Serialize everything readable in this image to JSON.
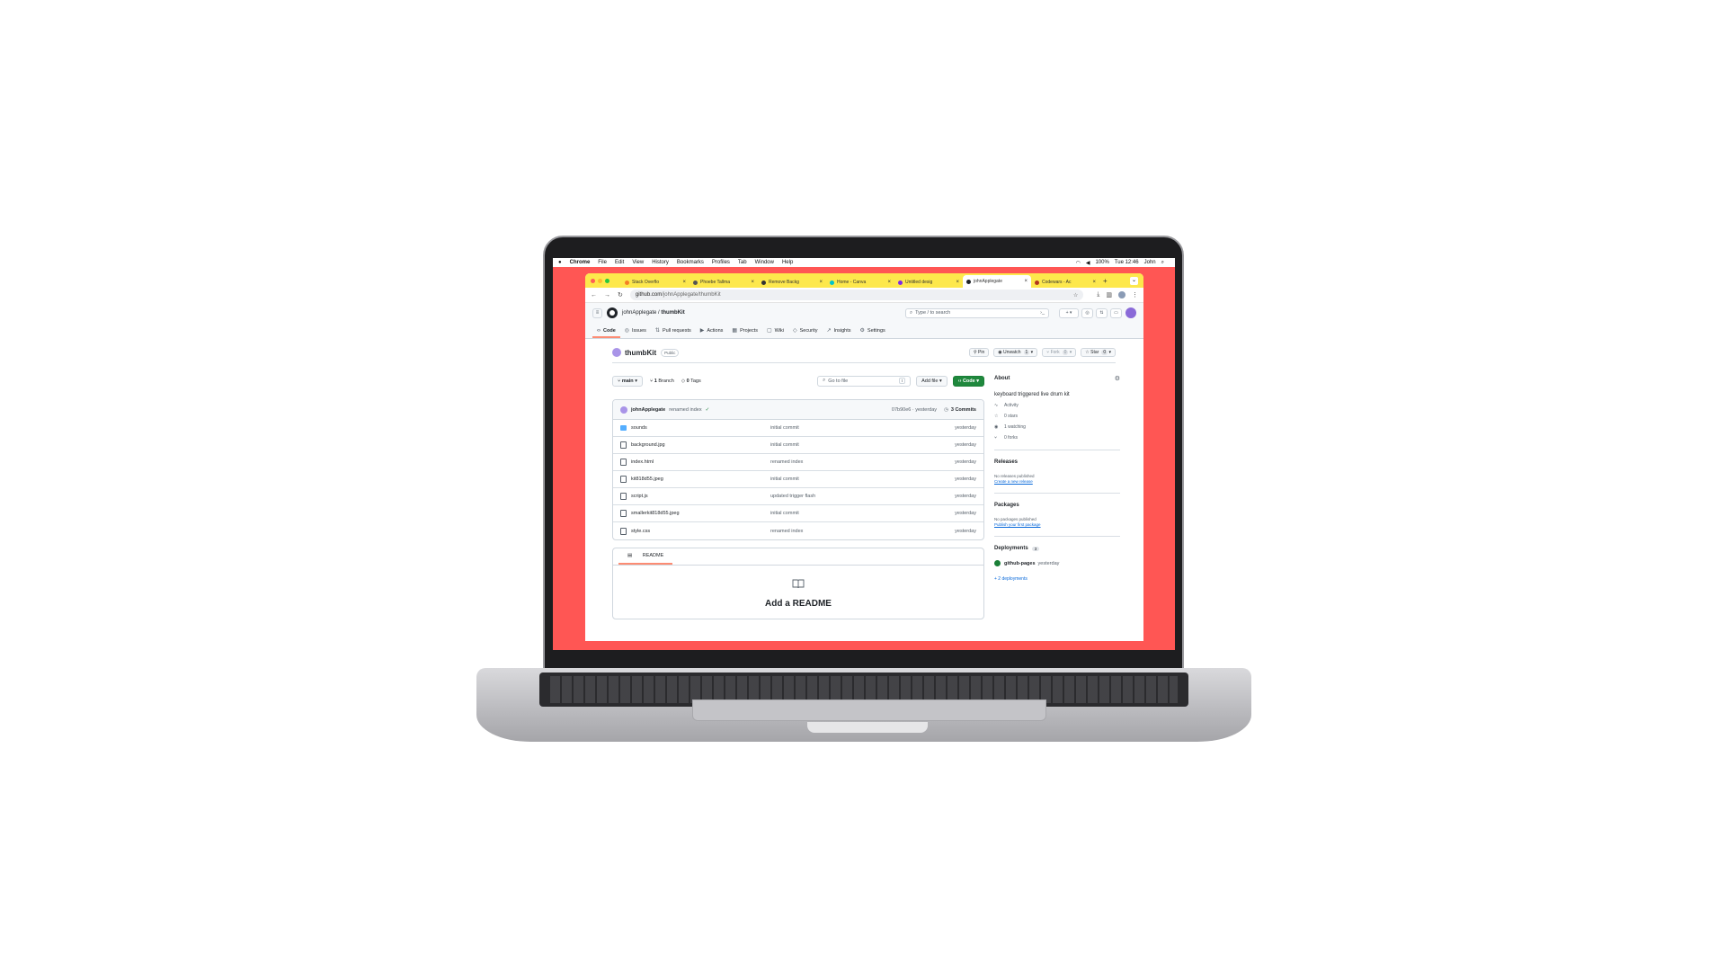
{
  "menubar": {
    "apple": "",
    "app": "Chrome",
    "items": [
      "File",
      "Edit",
      "View",
      "History",
      "Bookmarks",
      "Profiles",
      "Tab",
      "Window",
      "Help"
    ],
    "battery": "100%",
    "clock": "Tue 12:46",
    "user": "John"
  },
  "browser": {
    "tabs": [
      {
        "title": "Stack Overflo",
        "color": "#f48024"
      },
      {
        "title": "Phoebe Tallma",
        "color": "#555555"
      },
      {
        "title": "Remove Backg",
        "color": "#333333"
      },
      {
        "title": "Home - Canva",
        "color": "#00c4cc"
      },
      {
        "title": "Untitled desig",
        "color": "#7d2ae8"
      },
      {
        "title": "johnApplegate",
        "color": "#1f2328"
      },
      {
        "title": "Codewars - Ac",
        "color": "#b1361e"
      }
    ],
    "active_tab": 5,
    "url_host": "github.com",
    "url_path": "/johnApplegate/thumbKit"
  },
  "github": {
    "owner": "johnApplegate",
    "repo": "thumbKit",
    "search_placeholder": "Type / to search",
    "repo_nav": [
      {
        "label": "Code",
        "icon": "code-icon",
        "glyph": "‹›"
      },
      {
        "label": "Issues",
        "icon": "issue-icon",
        "glyph": "◎"
      },
      {
        "label": "Pull requests",
        "icon": "pull-request-icon",
        "glyph": "⇅"
      },
      {
        "label": "Actions",
        "icon": "play-icon",
        "glyph": "▶"
      },
      {
        "label": "Projects",
        "icon": "table-icon",
        "glyph": "▦"
      },
      {
        "label": "Wiki",
        "icon": "book-icon",
        "glyph": "▢"
      },
      {
        "label": "Security",
        "icon": "shield-icon",
        "glyph": "◇"
      },
      {
        "label": "Insights",
        "icon": "graph-icon",
        "glyph": "↗"
      },
      {
        "label": "Settings",
        "icon": "gear-icon",
        "glyph": "⚙"
      }
    ],
    "visibility": "Public",
    "actions": {
      "pin": "Pin",
      "unwatch": "Unwatch",
      "unwatch_count": "1",
      "fork": "Fork",
      "fork_count": "0",
      "star": "Star",
      "star_count": "0"
    },
    "branch": "main",
    "branch_count": "1",
    "branch_label": "Branch",
    "tag_count": "0",
    "tag_label": "Tags",
    "goto_placeholder": "Go to file",
    "goto_key": "t",
    "add_file": "Add file",
    "code_button": "Code",
    "latest_commit": {
      "user": "johnApplegate",
      "message": "renamed index",
      "hash_time": "07b90e6 · yesterday",
      "commits": "3 Commits"
    },
    "files": [
      {
        "name": "sounds",
        "type": "folder",
        "message": "initial commit",
        "date": "yesterday"
      },
      {
        "name": "background.jpg",
        "type": "file",
        "message": "initial commit",
        "date": "yesterday"
      },
      {
        "name": "index.html",
        "type": "file",
        "message": "renamed index",
        "date": "yesterday"
      },
      {
        "name": "kit818d55.jpeg",
        "type": "file",
        "message": "initial commit",
        "date": "yesterday"
      },
      {
        "name": "script.js",
        "type": "file",
        "message": "updated trigger flash",
        "date": "yesterday"
      },
      {
        "name": "smallerkit818d55.jpeg",
        "type": "file",
        "message": "initial commit",
        "date": "yesterday"
      },
      {
        "name": "style.css",
        "type": "file",
        "message": "renamed index",
        "date": "yesterday"
      }
    ],
    "readme_tab": "README",
    "add_readme": "Add a README",
    "about": {
      "title": "About",
      "description": "keyboard triggered live drum kit",
      "activity": "Activity",
      "stars": "0 stars",
      "watching": "1 watching",
      "forks": "0 forks"
    },
    "releases": {
      "title": "Releases",
      "none": "No releases published",
      "link": "Create a new release"
    },
    "packages": {
      "title": "Packages",
      "none": "No packages published",
      "link": "Publish your first package"
    },
    "deployments": {
      "title": "Deployments",
      "count": "3",
      "env": "github-pages",
      "when": "yesterday",
      "more": "+ 2 deployments"
    }
  }
}
